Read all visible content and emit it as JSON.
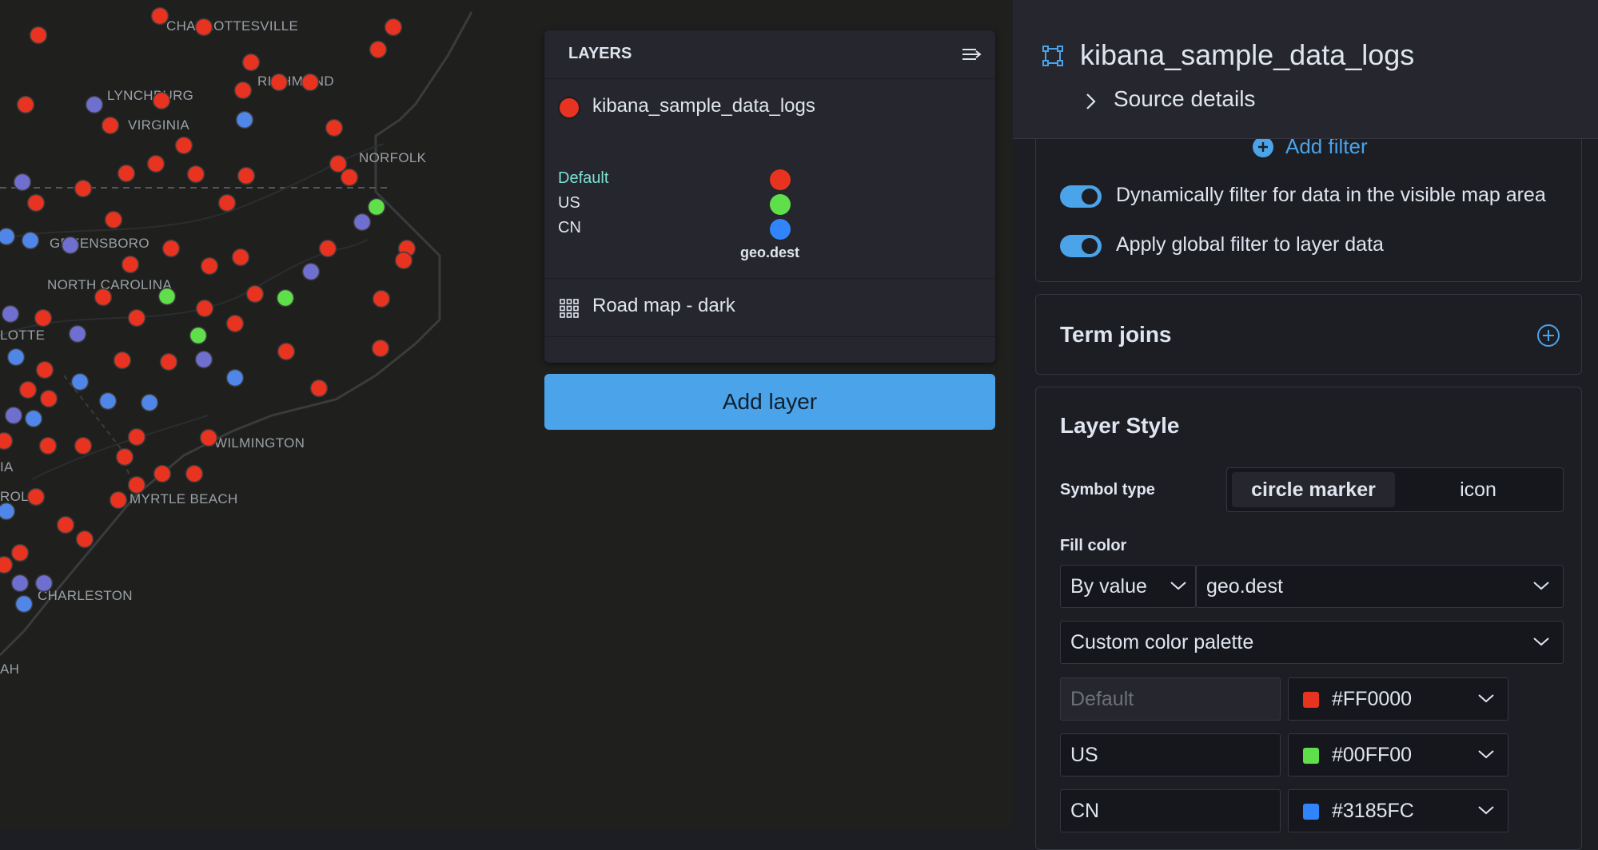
{
  "map": {
    "labels": {
      "charlottesville": "CHARLOTTESVILLE",
      "richmond": "RICHMOND",
      "lynchburg": "LYNCHBURG",
      "virginia": "VIRGINIA",
      "norfolk": "NORFOLK",
      "greensboro": "GREENSBORO",
      "north_carolina": "NORTH CAROLINA",
      "charlotte": "LOTTE",
      "wilmington": "WILMINGTON",
      "myrtle_beach": "MYRTLE BEACH",
      "charleston": "CHARLESTON",
      "carolina_partial": "ROLI",
      "ia_partial": "IA",
      "ah_partial": "AH"
    },
    "colors": {
      "default": "#e7331f",
      "us": "#5fe04a",
      "cn": "#4f86e8",
      "other": "#6f6fd0"
    }
  },
  "layers_panel": {
    "title": "LAYERS",
    "collapse_icon": "collapse-right-icon",
    "layers": [
      {
        "name": "kibana_sample_data_logs",
        "color": "#e7331f"
      },
      {
        "name": "Road map - dark",
        "icon": "grid-icon"
      }
    ],
    "legend": {
      "items": [
        {
          "label": "Default",
          "color": "#e7331f"
        },
        {
          "label": "US",
          "color": "#5fe04a"
        },
        {
          "label": "CN",
          "color": "#3185fc"
        }
      ],
      "field": "geo.dest"
    },
    "add_layer_label": "Add layer"
  },
  "editor": {
    "title": "kibana_sample_data_logs",
    "source_details": "Source details",
    "add_filter": "Add filter",
    "toggles": [
      {
        "label": "Dynamically filter for data in the visible map area",
        "on": true
      },
      {
        "label": "Apply global filter to layer data",
        "on": true
      }
    ],
    "term_joins": "Term joins",
    "layer_style": {
      "title": "Layer Style",
      "symbol_type_label": "Symbol type",
      "symbol_options": [
        "circle marker",
        "icon"
      ],
      "fill_color_label": "Fill color",
      "by_value": "By value",
      "field": "geo.dest",
      "palette": "Custom color palette",
      "stops": [
        {
          "term": "",
          "placeholder": "Default",
          "color": "#FF0000",
          "swatch": "#e7331f"
        },
        {
          "term": "US",
          "color": "#00FF00",
          "swatch": "#5fe04a"
        },
        {
          "term": "CN",
          "color": "#3185FC",
          "swatch": "#3185fc"
        }
      ]
    }
  }
}
